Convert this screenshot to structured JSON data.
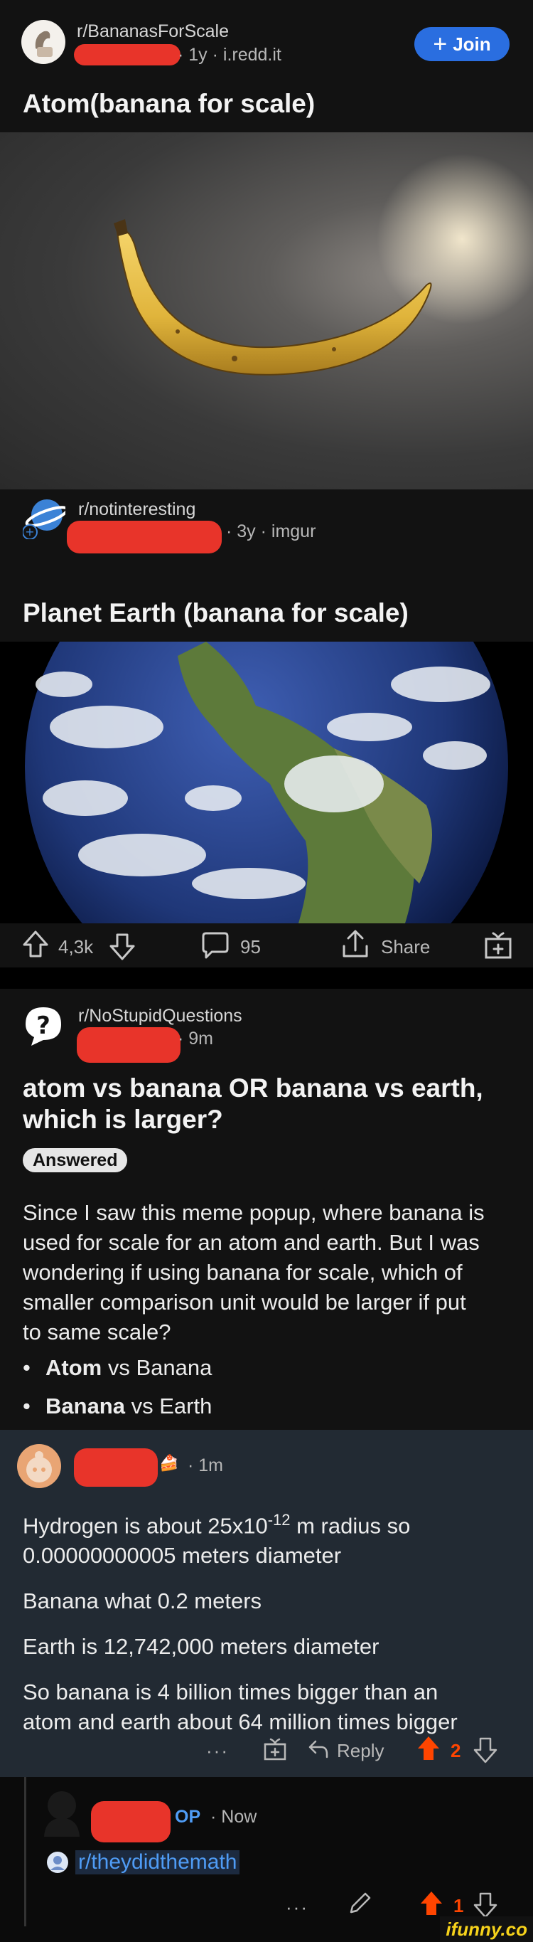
{
  "post1": {
    "subreddit": "r/BananasForScale",
    "meta": "· 1y · i.redd.it",
    "join_label": "Join",
    "title": "Atom(banana for scale)"
  },
  "post2": {
    "subreddit": "r/notinteresting",
    "meta": "· 3y · imgur",
    "title": "Planet Earth (banana for scale)",
    "upvotes": "4,3k",
    "comments": "95",
    "share_label": "Share"
  },
  "post3": {
    "subreddit": "r/NoStupidQuestions",
    "meta": "· 9m",
    "title_line1": "atom vs banana OR banana vs earth,",
    "title_line2": "which is larger?",
    "flair": "Answered",
    "body_lines": [
      "Since I saw this meme popup, where banana is",
      "used for scale for an atom and earth. But I was",
      "wondering if using banana for scale, which of",
      "smaller comparison unit would be larger if put",
      "to same scale?"
    ],
    "bullets": [
      {
        "bold": "Atom",
        "rest": " vs Banana"
      },
      {
        "bold": "Banana",
        "rest": " vs Earth"
      }
    ]
  },
  "comment1": {
    "time": "· 1m",
    "line1_pre": "Hydrogen is about 25x10",
    "line1_sup": "-12",
    "line1_post": " m radius so",
    "line2": "0.00000000005 meters diameter",
    "para2": "Banana what 0.2 meters",
    "para3": "Earth is 12,742,000 meters diameter",
    "para4_line1": "So banana is 4 billion times bigger than an",
    "para4_line2": "atom and earth about 64 million times bigger",
    "reply_label": "Reply",
    "score": "2"
  },
  "comment2": {
    "op_label": "OP",
    "time": "· Now",
    "link": "r/theydidthemath",
    "score": "1"
  },
  "watermark": "ifunny.co"
}
